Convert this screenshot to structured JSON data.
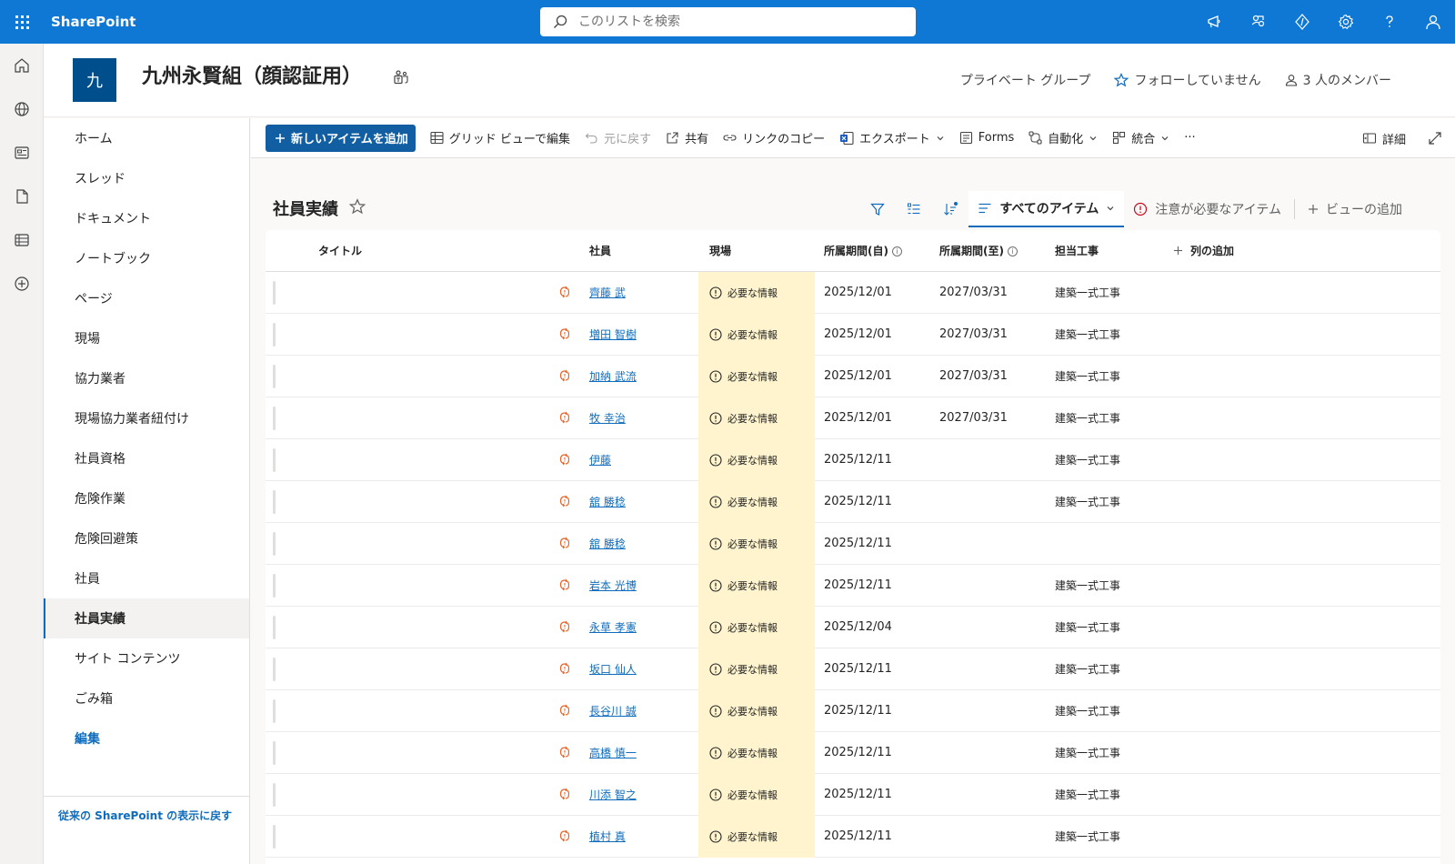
{
  "suitebar": {
    "app_name": "SharePoint",
    "search_placeholder": "このリストを検索",
    "icons": [
      "feedback-icon",
      "share-people-icon",
      "developer-icon",
      "settings-icon",
      "help-icon",
      "account-icon"
    ]
  },
  "appbar": {
    "icons": [
      "home-icon",
      "globe-icon",
      "news-icon",
      "document-icon",
      "list-icon",
      "add-icon"
    ]
  },
  "site": {
    "logo_letter": "九",
    "title": "九州永賢組（顔認証用）",
    "group_type": "プライベート グループ",
    "follow_label": "フォローしていません",
    "members_label": "3 人のメンバー"
  },
  "leftnav": {
    "items": [
      {
        "label": "ホーム"
      },
      {
        "label": "スレッド"
      },
      {
        "label": "ドキュメント"
      },
      {
        "label": "ノートブック"
      },
      {
        "label": "ページ"
      },
      {
        "label": "現場"
      },
      {
        "label": "協力業者"
      },
      {
        "label": "現場協力業者紐付け"
      },
      {
        "label": "社員資格"
      },
      {
        "label": "危険作業"
      },
      {
        "label": "危険回避策"
      },
      {
        "label": "社員"
      },
      {
        "label": "社員実績"
      },
      {
        "label": "サイト コンテンツ"
      },
      {
        "label": "ごみ箱"
      },
      {
        "label": "編集"
      }
    ],
    "selected": "社員実績",
    "classic_link": "従来の SharePoint の表示に戻す"
  },
  "commandbar": {
    "new_item": "新しいアイテムを追加",
    "grid_edit": "グリッド ビューで編集",
    "undo": "元に戻す",
    "share": "共有",
    "copy_link": "リンクのコピー",
    "export": "エクスポート",
    "forms": "Forms",
    "automate": "自動化",
    "integrate": "統合",
    "more": "···",
    "details": "詳細"
  },
  "list": {
    "title": "社員実績",
    "views": {
      "active": "すべてのアイテム",
      "attention": "注意が必要なアイテム",
      "add_view": "ビューの追加"
    },
    "columns": {
      "title": "タイトル",
      "employee": "社員",
      "site": "現場",
      "from": "所属期間(自)",
      "to": "所属期間(至)",
      "work": "担当工事",
      "add_column": "列の追加"
    },
    "rows": [
      {
        "employee": "齊藤 武",
        "site": "必要な情報",
        "from": "2025/12/01",
        "to": "2027/03/31",
        "work": "建築一式工事"
      },
      {
        "employee": "増田 智樹",
        "site": "必要な情報",
        "from": "2025/12/01",
        "to": "2027/03/31",
        "work": "建築一式工事"
      },
      {
        "employee": "加納 武流",
        "site": "必要な情報",
        "from": "2025/12/01",
        "to": "2027/03/31",
        "work": "建築一式工事"
      },
      {
        "employee": "牧 幸治",
        "site": "必要な情報",
        "from": "2025/12/01",
        "to": "2027/03/31",
        "work": "建築一式工事"
      },
      {
        "employee": "伊藤",
        "site": "必要な情報",
        "from": "2025/12/11",
        "to": "",
        "work": "建築一式工事"
      },
      {
        "employee": "舘 勝稔",
        "site": "必要な情報",
        "from": "2025/12/11",
        "to": "",
        "work": "建築一式工事"
      },
      {
        "employee": "舘 勝稔",
        "site": "必要な情報",
        "from": "2025/12/11",
        "to": "",
        "work": ""
      },
      {
        "employee": "岩本 光博",
        "site": "必要な情報",
        "from": "2025/12/11",
        "to": "",
        "work": "建築一式工事"
      },
      {
        "employee": "永草 孝憲",
        "site": "必要な情報",
        "from": "2025/12/04",
        "to": "",
        "work": "建築一式工事"
      },
      {
        "employee": "坂口 仙人",
        "site": "必要な情報",
        "from": "2025/12/11",
        "to": "",
        "work": "建築一式工事"
      },
      {
        "employee": "長谷川 誠",
        "site": "必要な情報",
        "from": "2025/12/11",
        "to": "",
        "work": "建築一式工事"
      },
      {
        "employee": "高橋 慎一",
        "site": "必要な情報",
        "from": "2025/12/11",
        "to": "",
        "work": "建築一式工事"
      },
      {
        "employee": "川添 智之",
        "site": "必要な情報",
        "from": "2025/12/11",
        "to": "",
        "work": "建築一式工事"
      },
      {
        "employee": "植村 真",
        "site": "必要な情報",
        "from": "2025/12/11",
        "to": "",
        "work": "建築一式工事"
      }
    ]
  },
  "colors": {
    "suitebar": "#0f78d4",
    "primary_button": "#115ea3",
    "link": "#0f6cbd",
    "warning_cell": "#fff4ce",
    "sync_icon": "#e0652c"
  }
}
